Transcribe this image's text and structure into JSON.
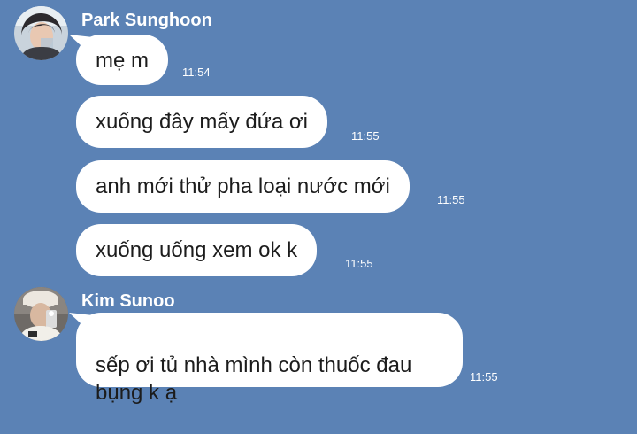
{
  "chat": {
    "groups": [
      {
        "sender": "Park Sunghoon",
        "avatar_icon": "profile-photo-icon",
        "messages": [
          {
            "text": "mẹ m",
            "time": "11:54"
          },
          {
            "text": "xuống đây mấy đứa ơi",
            "time": "11:55"
          },
          {
            "text": "anh mới thử pha loại nước mới",
            "time": "11:55"
          },
          {
            "text": "xuống uống xem ok k",
            "time": "11:55"
          }
        ]
      },
      {
        "sender": "Kim Sunoo",
        "avatar_icon": "profile-photo-icon",
        "messages": [
          {
            "text": "sếp ơi tủ nhà mình còn thuốc đau\nbụng k ạ",
            "time": "11:55"
          }
        ]
      }
    ]
  },
  "colors": {
    "background": "#5b82b5",
    "bubble": "#ffffff",
    "text": "#1c1c1c"
  }
}
